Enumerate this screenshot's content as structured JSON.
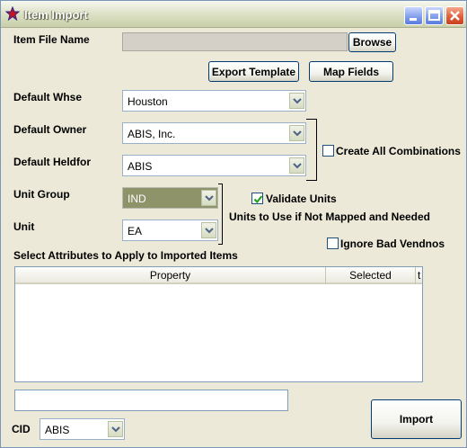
{
  "window": {
    "title": "Item Import",
    "icon": "star-app-icon",
    "controls": [
      "minimize-icon",
      "maximize-icon",
      "close-icon"
    ]
  },
  "item_file": {
    "label": "Item File Name",
    "value": "",
    "browse_label": "Browse"
  },
  "buttons": {
    "export_template": "Export Template",
    "map_fields": "Map Fields",
    "import": "Import"
  },
  "default_whse": {
    "label": "Default Whse",
    "value": "Houston"
  },
  "default_owner": {
    "label": "Default Owner",
    "value": "ABIS, Inc."
  },
  "default_heldfor": {
    "label": "Default Heldfor",
    "value": "ABIS"
  },
  "create_all": {
    "label": "Create All Combinations",
    "checked": false
  },
  "unit_group": {
    "label": "Unit Group",
    "value": "IND"
  },
  "unit": {
    "label": "Unit",
    "value": "EA"
  },
  "validate_units": {
    "label": "Validate Units",
    "checked": true
  },
  "units_note": "Units to Use if Not Mapped and Needed",
  "ignore_bad_vendnos": {
    "label": "Ignore Bad Vendnos",
    "checked": false
  },
  "attributes": {
    "label": "Select Attributes to Apply to Imported Items",
    "columns": [
      "Property",
      "Selected",
      "t"
    ],
    "rows": []
  },
  "status_field": {
    "value": ""
  },
  "cid": {
    "label": "CID",
    "value": "ABIS"
  },
  "colors": {
    "face": "#ece9d8",
    "title_gradient_end": "#c9cfa8",
    "selected_combo": "#8f9369",
    "checkmark": "#21a121"
  }
}
